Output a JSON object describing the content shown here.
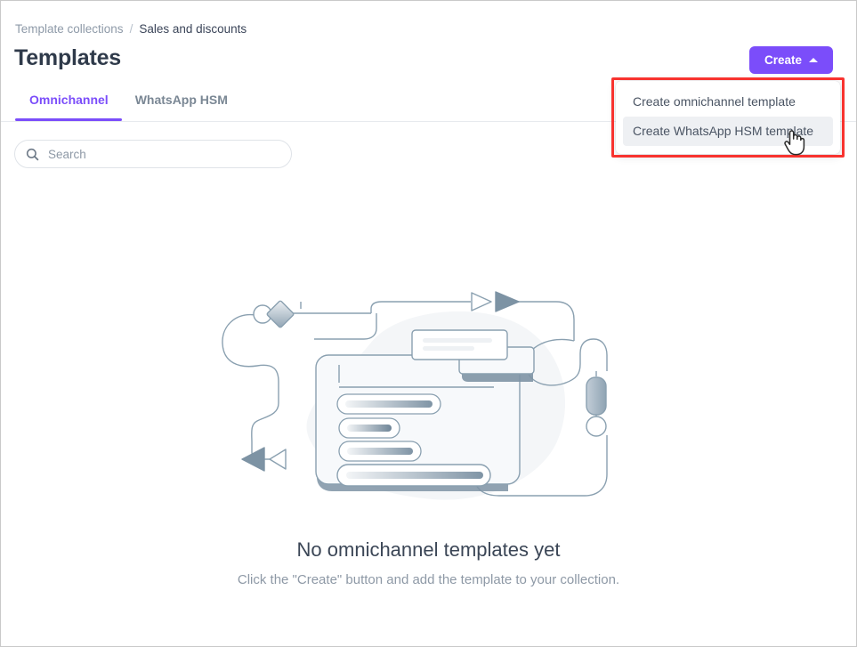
{
  "window": {
    "border_color": "#c9c9c9",
    "background": "#ffffff"
  },
  "breadcrumb": {
    "parent_label": "Template collections",
    "separator": "/",
    "current_label": "Sales and discounts"
  },
  "header": {
    "title": "Templates"
  },
  "toolbar": {
    "create_label": "Create",
    "create_accent_color": "#7b4dfa",
    "caret_icon": "chevron-up-icon"
  },
  "tabs": [
    {
      "label": "Omnichannel",
      "active": true
    },
    {
      "label": "WhatsApp HSM",
      "active": false
    }
  ],
  "search": {
    "placeholder": "Search",
    "value": "",
    "icon": "search-icon"
  },
  "dropdown": {
    "open": true,
    "items": [
      {
        "label": "Create omnichannel template",
        "hovered": false
      },
      {
        "label": "Create WhatsApp HSM template",
        "hovered": true
      }
    ],
    "hover_background": "#eef0f3"
  },
  "annotation": {
    "type": "highlight-rectangle",
    "color": "#f8332f"
  },
  "cursor": {
    "type": "pointer-hand-cursor"
  },
  "empty_state": {
    "illustration": "templates-empty-illustration",
    "title": "No omnichannel templates yet",
    "subtitle": "Click the \"Create\" button and add the template to your collection."
  }
}
